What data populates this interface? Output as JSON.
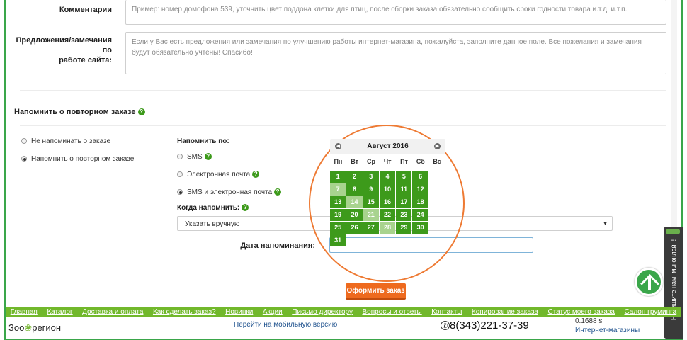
{
  "form": {
    "comments_label": "Комментарии",
    "comments_placeholder": "Пример: номер домофона 539, уточнить цвет поддона клетки для птиц, после сборки заказа обязательно сообщить сроки годности товара и.т.д. и.т.п.",
    "suggestions_label_line1": "Предложения/замечания по",
    "suggestions_label_line2": "работе сайта:",
    "suggestions_placeholder": "Если у Вас есть предложения или замечания по улучшению работы интернет-магазина, пожалуйста, заполните данное поле. Все пожелания и замечания будут обязательно учтены! Спасибо!"
  },
  "reminder": {
    "title": "Напомнить о повторном заказе",
    "options": [
      {
        "label": "Не напоминать о заказе",
        "selected": false
      },
      {
        "label": "Напомнить о повторном заказе",
        "selected": true
      }
    ],
    "remind_by_label": "Напомнить по:",
    "channels": [
      {
        "label": "SMS",
        "selected": false
      },
      {
        "label": "Электронная почта",
        "selected": false
      },
      {
        "label": "SMS и электронная почта",
        "selected": true
      }
    ],
    "when_label": "Когда напомнить:",
    "when_value": "Указать вручную",
    "date_label": "Дата напоминания:",
    "date_value": ""
  },
  "calendar": {
    "month_label": "Август 2016",
    "weekdays": [
      "Пн",
      "Вт",
      "Ср",
      "Чт",
      "Пт",
      "Сб",
      "Вс"
    ],
    "days": [
      "1",
      "2",
      "3",
      "4",
      "5",
      "6",
      "7",
      "8",
      "9",
      "10",
      "11",
      "12",
      "13",
      "14",
      "15",
      "16",
      "17",
      "18",
      "19",
      "20",
      "21",
      "22",
      "23",
      "24",
      "25",
      "26",
      "27",
      "28",
      "29",
      "30",
      "31"
    ]
  },
  "order_button": "Оформить заказ",
  "nav": {
    "items": [
      "Главная",
      "Каталог",
      "Доставка и оплата",
      "Как сделать заказ?",
      "Новинки",
      "Акции",
      "Письмо директору",
      "Вопросы и ответы",
      "Контакты",
      "Копирование заказа",
      "Статус моего заказа",
      "Салон груминга"
    ]
  },
  "footer": {
    "logo_part1": "Зоо",
    "logo_part2": "регион",
    "mobile_link": "Перейти на мобильную версию",
    "phone": "8(343)221-37-39",
    "timing": "0.1688 s",
    "catalog_link": "Интернет-магазины"
  },
  "chat_widget": "Напишите нам, мы онлайн!",
  "colors": {
    "accent_green": "#3d9a1b",
    "nav_green": "#71b82b",
    "order_orange": "#ee6a1e",
    "highlight_circle": "#ee7a33"
  }
}
